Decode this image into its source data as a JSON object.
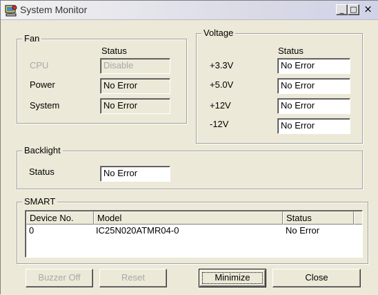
{
  "window": {
    "title": "System Monitor",
    "icon": "computer-monitor-icon",
    "controls": {
      "minimize": "_",
      "maximize": "□",
      "close": "×"
    }
  },
  "fan": {
    "title": "Fan",
    "status_header": "Status",
    "rows": [
      {
        "label": "CPU",
        "value": "Disable",
        "disabled": true
      },
      {
        "label": "Power",
        "value": "No Error",
        "disabled": false
      },
      {
        "label": "System",
        "value": "No Error",
        "disabled": false
      }
    ]
  },
  "voltage": {
    "title": "Voltage",
    "status_header": "Status",
    "rows": [
      {
        "label": "+3.3V",
        "value": "No Error"
      },
      {
        "label": "+5.0V",
        "value": "No Error"
      },
      {
        "label": "+12V",
        "value": "No Error"
      },
      {
        "label": "-12V",
        "value": "No Error"
      }
    ]
  },
  "backlight": {
    "title": "Backlight",
    "label": "Status",
    "value": "No Error"
  },
  "smart": {
    "title": "SMART",
    "columns": [
      "Device No.",
      "Model",
      "Status"
    ],
    "rows": [
      {
        "device": "0",
        "model": "IC25N020ATMR04-0",
        "status": "No Error"
      }
    ]
  },
  "buttons": {
    "buzzer_off": "Buzzer Off",
    "reset": "Reset",
    "minimize": "Minimize",
    "close": "Close"
  },
  "colors": {
    "face": "#ece9d8",
    "disabled_text": "#a8a8a8",
    "field_white": "#ffffff"
  }
}
